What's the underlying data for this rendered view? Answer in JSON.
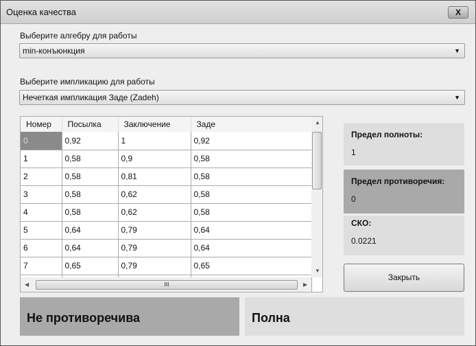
{
  "window": {
    "title": "Оценка качества",
    "close": "X"
  },
  "algebra": {
    "label": "Выберите алгебру для работы",
    "value": "min-конъюнкция"
  },
  "implication": {
    "label": "Выберите импликацию для работы",
    "value": "Нечеткая импликация Заде (Zadeh)"
  },
  "table": {
    "headers": [
      "Номер",
      "Посылка",
      "Заключение",
      "Заде"
    ],
    "rows": [
      [
        "0",
        "0,92",
        "1",
        "0,92"
      ],
      [
        "1",
        "0,58",
        "0,9",
        "0,58"
      ],
      [
        "2",
        "0,58",
        "0,81",
        "0,58"
      ],
      [
        "3",
        "0,58",
        "0,62",
        "0,58"
      ],
      [
        "4",
        "0,58",
        "0,62",
        "0,58"
      ],
      [
        "5",
        "0,64",
        "0,79",
        "0,64"
      ],
      [
        "6",
        "0,64",
        "0,79",
        "0,64"
      ],
      [
        "7",
        "0,65",
        "0,79",
        "0,65"
      ]
    ]
  },
  "stats": {
    "completeness_label": "Предел полноты:",
    "completeness_value": "1",
    "contradiction_label": "Предел противоречия:",
    "contradiction_value": "0",
    "rmse_label": "СКО:",
    "rmse_value": "0.0221"
  },
  "close_button": "Закрыть",
  "status": {
    "contradiction": "Не противоречива",
    "completeness": "Полна"
  }
}
